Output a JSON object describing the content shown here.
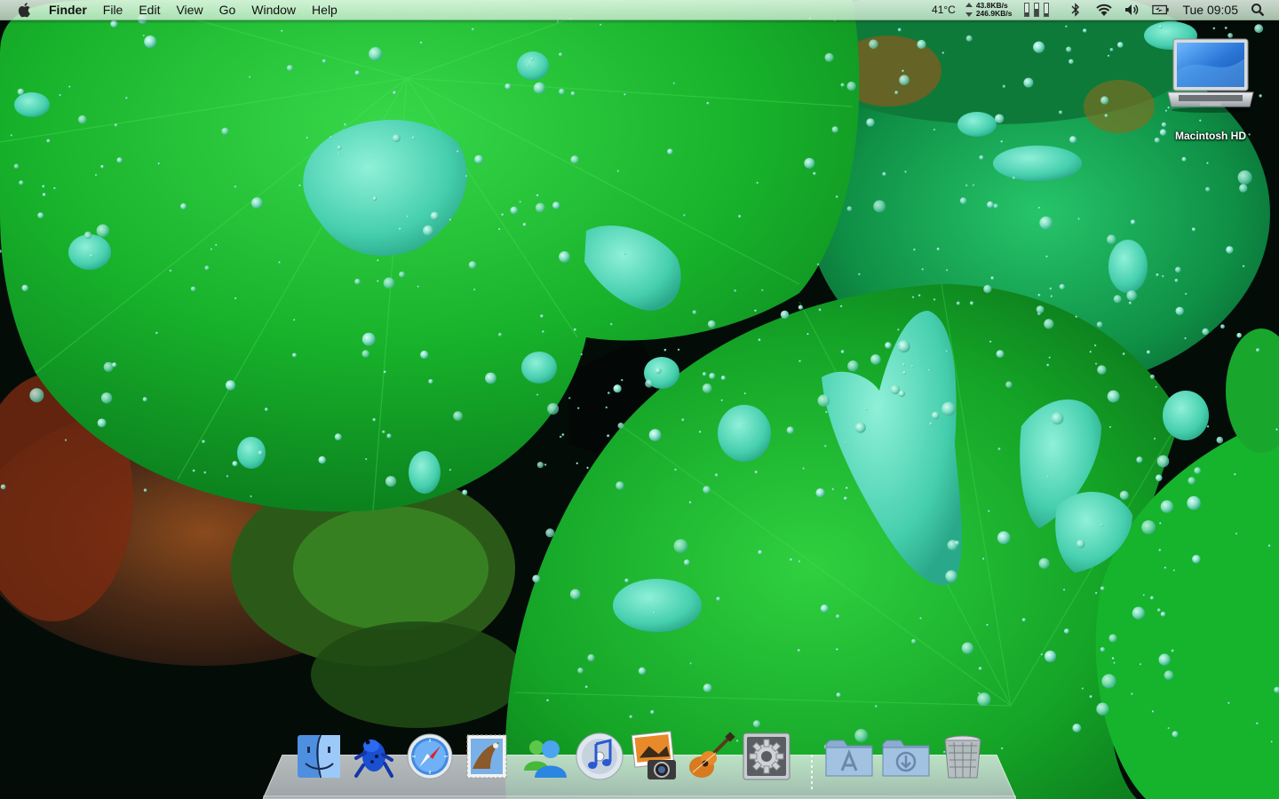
{
  "menubar": {
    "app_name": "Finder",
    "menus": [
      "File",
      "Edit",
      "View",
      "Go",
      "Window",
      "Help"
    ],
    "temperature": "41°C",
    "net_up": "43.8KB/s",
    "net_down": "246.9KB/s",
    "clock": "Tue 09:05"
  },
  "desktop": {
    "icons": [
      {
        "label": "Macintosh HD",
        "icon": "laptop-icon"
      }
    ]
  },
  "dock": {
    "items": [
      {
        "name": "finder-icon"
      },
      {
        "name": "frog-icon"
      },
      {
        "name": "safari-icon"
      },
      {
        "name": "mail-icon"
      },
      {
        "name": "messenger-icon"
      },
      {
        "name": "itunes-icon"
      },
      {
        "name": "iphoto-icon"
      },
      {
        "name": "garageband-icon"
      },
      {
        "name": "system-preferences-icon"
      },
      {
        "name": "applications-folder-icon"
      },
      {
        "name": "downloads-folder-icon"
      },
      {
        "name": "trash-icon"
      }
    ]
  },
  "colors": {
    "leaf_bright": "#1bbf2a",
    "leaf_dark": "#0d7a1e",
    "droplet": "#5cd6b8",
    "menubar": "#e3f6e6"
  }
}
